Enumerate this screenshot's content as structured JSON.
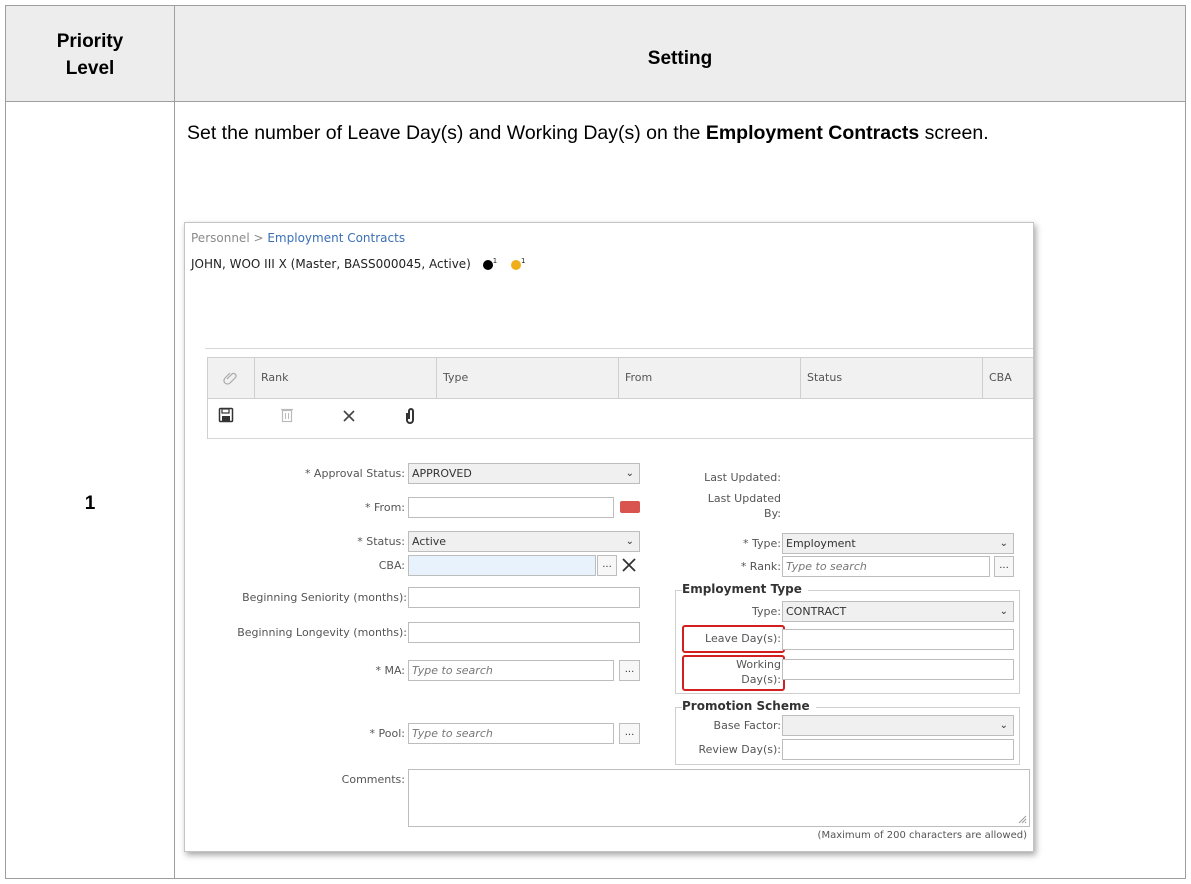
{
  "table": {
    "header_priority": "Priority Level",
    "header_setting": "Setting",
    "row_number": "1",
    "row_text_before": "Set the number of Leave Day(s) and Working Day(s) on the ",
    "row_text_bold": "Employment Contracts",
    "row_text_after": " screen."
  },
  "app": {
    "breadcrumb_root": "Personnel > ",
    "breadcrumb_current": "Employment Contracts",
    "person": "JOHN, WOO III X (Master, BASS000045, Active)",
    "badge_black_count": "1",
    "badge_orange_count": "1",
    "badge_colors": {
      "black": "#000000",
      "orange": "#f0ad1a"
    },
    "grid_columns": [
      "Rank",
      "Type",
      "From",
      "Status",
      "CBA"
    ],
    "toolbar_icons": [
      "paperclip-icon",
      "save-icon",
      "trash-icon",
      "close-icon",
      "attachment-icon"
    ],
    "form": {
      "approval_status_label": "* Approval Status:",
      "approval_status_value": "APPROVED",
      "from_label": "* From:",
      "status_label": "* Status:",
      "status_value": "Active",
      "cba_label": "CBA:",
      "beginning_seniority_label": "Beginning Seniority (months):",
      "beginning_longevity_label": "Beginning Longevity (months):",
      "ma_label": "* MA:",
      "ma_placeholder": "Type to search",
      "pool_label": "* Pool:",
      "pool_placeholder": "Type to search",
      "comments_label": "Comments:",
      "comments_note": "(Maximum of 200 characters are allowed)",
      "last_updated_label": "Last Updated:",
      "last_updated_by_label_1": "Last Updated",
      "last_updated_by_label_2": "By:",
      "type_label": "* Type:",
      "type_value": "Employment",
      "rank_label": "* Rank:",
      "rank_placeholder": "Type to search",
      "employment_type_title": "Employment Type",
      "emp_type_label": "Type:",
      "emp_type_value": "CONTRACT",
      "leave_days_label": "Leave Day(s):",
      "working_days_label_1": "Working",
      "working_days_label_2": "Day(s):",
      "promotion_scheme_title": "Promotion Scheme",
      "base_factor_label": "Base Factor:",
      "review_days_label": "Review Day(s):",
      "lookup_button": "...",
      "highlight_color": "#d21f1f"
    }
  }
}
